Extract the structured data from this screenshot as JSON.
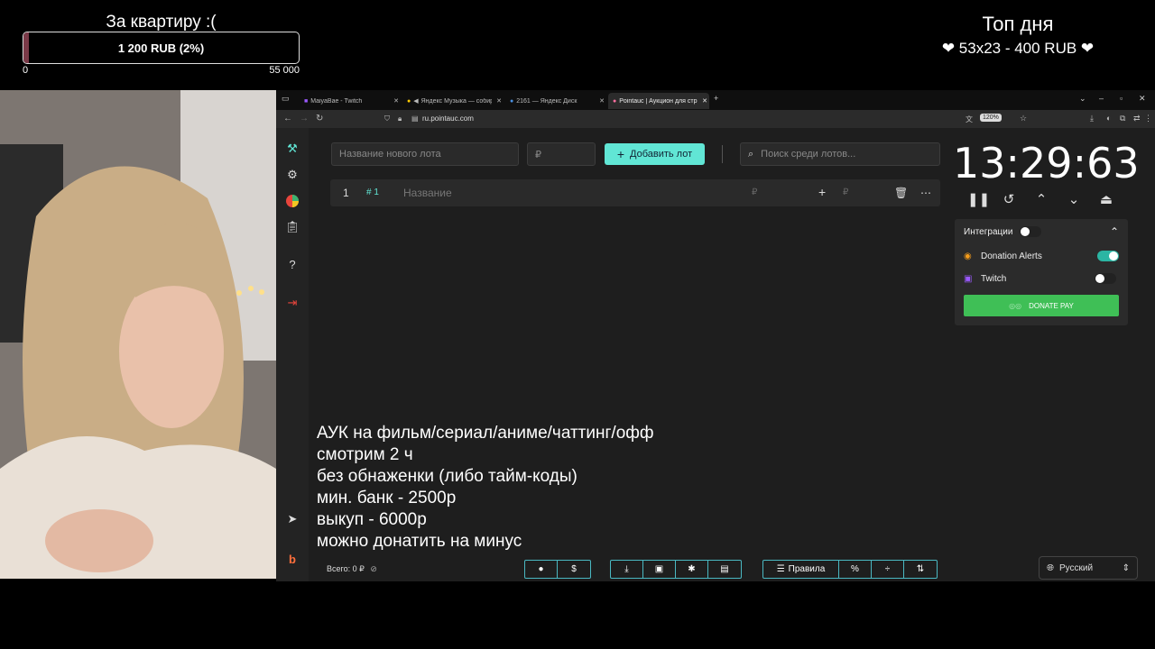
{
  "overlay": {
    "goal_title": "За квартиру :(",
    "goal_text": "1 200 RUB (2%)",
    "goal_progress": 0.02,
    "goal_min": "0",
    "goal_max": "55 000",
    "top_title": "Топ дня",
    "top_line": "❤ 53x23 - 400 RUB ❤"
  },
  "browser": {
    "tabs": [
      {
        "label": "MaiyaBae - Twitch"
      },
      {
        "label": "Яндекс Музыка — собирa"
      },
      {
        "label": "2161 — Яндекс Диск"
      },
      {
        "label": "Pointauc | Аукцион для стрим"
      }
    ],
    "url": "ru.pointauc.com",
    "zoom": "120%"
  },
  "app": {
    "lot_name_placeholder": "Название нового лота",
    "amount_placeholder": "₽",
    "add_lot_label": "Добавить лот",
    "search_placeholder": "Поиск среди лотов...",
    "lot": {
      "index": "1",
      "id": "# 1",
      "name_placeholder": "Название",
      "currency": "₽",
      "add_currency": "₽"
    },
    "timer": "13:29:63",
    "integrations": {
      "title": "Интеграции",
      "donation_alerts": "Donation Alerts",
      "twitch": "Twitch",
      "donate_pay": "DONATE PAY"
    },
    "rules_lines": [
      "АУК на фильм/сериал/аниме/чаттинг/офф",
      "смотрим 2 ч",
      "без обнаженки (либо тайм-коды)",
      "мин. банк - 2500р",
      "выкуп - 6000р",
      "можно донатить на минус"
    ],
    "total": "Всего: 0 ₽",
    "rules_button": "Правила",
    "language": "Русский"
  },
  "colors": {
    "accent": "#61e6d5",
    "donate_pay": "#3fbf56",
    "toggle_on": "#2bb5a3"
  }
}
